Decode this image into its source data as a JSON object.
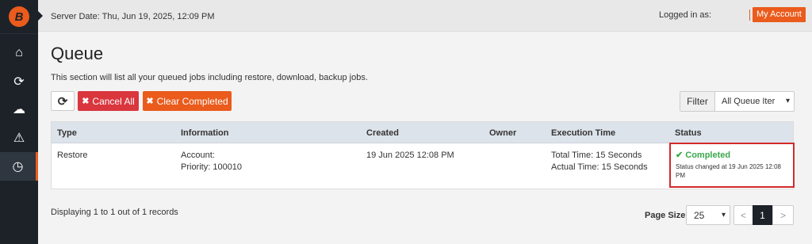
{
  "topbar": {
    "server_date": "Server Date: Thu, Jun 19, 2025, 12:09 PM",
    "logged_in": "Logged in as:",
    "account_button": "My Account"
  },
  "page": {
    "title": "Queue",
    "description": "This section will list all your queued jobs including restore, download, backup jobs."
  },
  "toolbar": {
    "refresh_glyph": "⟳",
    "cancel_all": "Cancel All",
    "clear_completed": "Clear Completed",
    "x_glyph": "✖",
    "filter_label": "Filter",
    "filter_value": "All Queue Iter"
  },
  "table": {
    "headers": [
      "Type",
      "Information",
      "Created",
      "Owner",
      "Execution Time",
      "Status"
    ],
    "rows": [
      {
        "type": "Restore",
        "info_line1": "Account:",
        "info_line2": "Priority: 100010",
        "created": "19 Jun 2025 12:08 PM",
        "owner": "",
        "exec_line1": "Total Time: 15 Seconds",
        "exec_line2": "Actual Time: 15 Seconds",
        "status": "✔ Completed",
        "status_detail": "Status changed at 19 Jun 2025 12:08 PM"
      }
    ]
  },
  "footer": {
    "records": "Displaying 1 to 1 out of 1 records",
    "page_size_label": "Page Size",
    "page_size": "25",
    "prev": "<",
    "page": "1",
    "next": ">"
  },
  "sidebar": {
    "logo": "B",
    "icons": [
      "home-icon",
      "sync-icon",
      "cloud-download-icon",
      "warning-icon",
      "clock-icon"
    ],
    "glyphs": [
      "⌂",
      "⟳",
      "☁",
      "⚠",
      "◷"
    ]
  },
  "colors": {
    "accent": "#ea5b1c",
    "danger": "#d9363e",
    "success": "#3aa74a",
    "sidebar": "#1d2229"
  }
}
